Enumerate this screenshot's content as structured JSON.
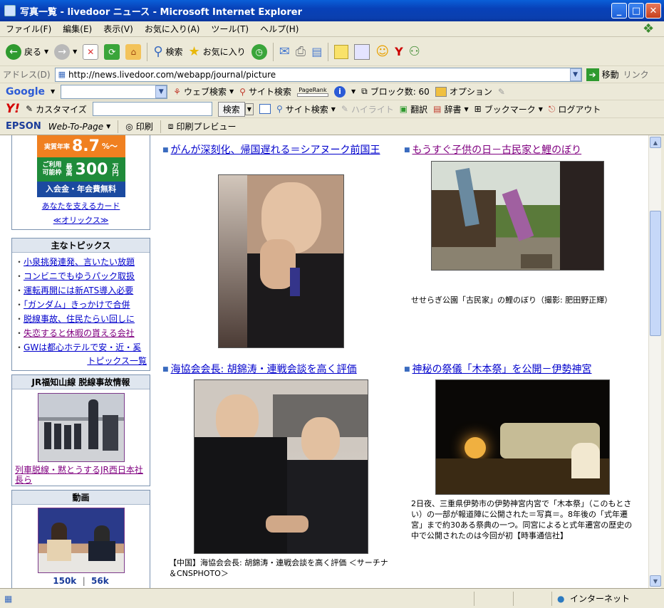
{
  "window": {
    "title": "写真一覧 - livedoor ニュース - Microsoft Internet Explorer"
  },
  "menu": [
    "ファイル(F)",
    "編集(E)",
    "表示(V)",
    "お気に入り(A)",
    "ツール(T)",
    "ヘルプ(H)"
  ],
  "toolbar": {
    "back": "戻る",
    "search": "検索",
    "favorites": "お気に入り"
  },
  "address": {
    "label": "アドレス(D)",
    "url": "http://news.livedoor.com/webapp/journal/picture",
    "go": "移動",
    "links": "リンク"
  },
  "google_bar": {
    "logo": "Google",
    "web_search": "ウェブ検索",
    "site_search": "サイト検索",
    "pagerank": "PageRank",
    "blocked": "ブロック数: 60",
    "options": "オプション"
  },
  "yahoo_bar": {
    "logo": "Y!",
    "customize": "カスタマイズ",
    "search_btn": "検索",
    "site_search": "サイト検索",
    "highlight": "ハイライト",
    "translate": "翻訳",
    "dictionary": "辞書",
    "bookmark": "ブックマーク",
    "logout": "ログアウト"
  },
  "epson_bar": {
    "logo": "EPSON",
    "web_to_page": "Web-To-Page",
    "print": "印刷",
    "print_preview": "印刷プレビュー"
  },
  "ad": {
    "rate_label": "実質年率",
    "rate": "8.7",
    "rate_suffix": "%〜",
    "limit_label1": "ご利用",
    "limit_label2": "可能枠",
    "limit_max": "最高",
    "limit_value": "300",
    "limit_unit": "万円",
    "fee": "入会金・年会費無料",
    "link1": "あなたを支えるカード",
    "link2": "≪オリックス≫"
  },
  "topics": {
    "heading": "主なトピックス",
    "items": [
      "小泉挑発連発、言いたい放題",
      "コンビニでもゆうパック取扱",
      "運転再開には新ATS導入必要",
      "「ガンダム」きっかけで合併",
      "脱線事故、住民たらい回しに",
      "失恋すると休暇の貰える会社",
      "GWは都心ホテルで安・近・奚"
    ],
    "more": "トピックス一覧"
  },
  "jr": {
    "heading": "JR福知山線 脱線事故情報",
    "caption": "列車脱線・黙とうするJR西日本社長ら"
  },
  "video": {
    "heading": "動画",
    "links": [
      "150k",
      "56k"
    ],
    "separator": "|"
  },
  "articles": [
    {
      "title": "がんが深刻化、帰国遅れる＝シアヌーク前国王",
      "caption": ""
    },
    {
      "title": "もうすぐ子供の日－古民家と鯉のぼり",
      "caption": "せせらぎ公園「古民家」の鯉のぼり（撮影: 肥田野正輝）"
    },
    {
      "title": "海協会会長: 胡錦涛・連戦会談を高く評価",
      "caption": "【中国】海協会会長: 胡錦涛・連戦会談を高く評価 ＜サーチナ＆CNSPHOTO＞"
    },
    {
      "title": "神秘の祭儀「木本祭」を公開－伊勢神宮",
      "caption": "2日夜、三重県伊勢市の伊勢神宮内宮で「木本祭」（このもとさい）の一部が報道陣に公開された＝写真＝。8年後の「式年遷宮」まで約30ある祭典の一つ。同宮によると式年遷宮の歴史の中で公開されたのは今回が初【時事通信社】"
    }
  ],
  "statusbar": {
    "zone": "インターネット"
  }
}
